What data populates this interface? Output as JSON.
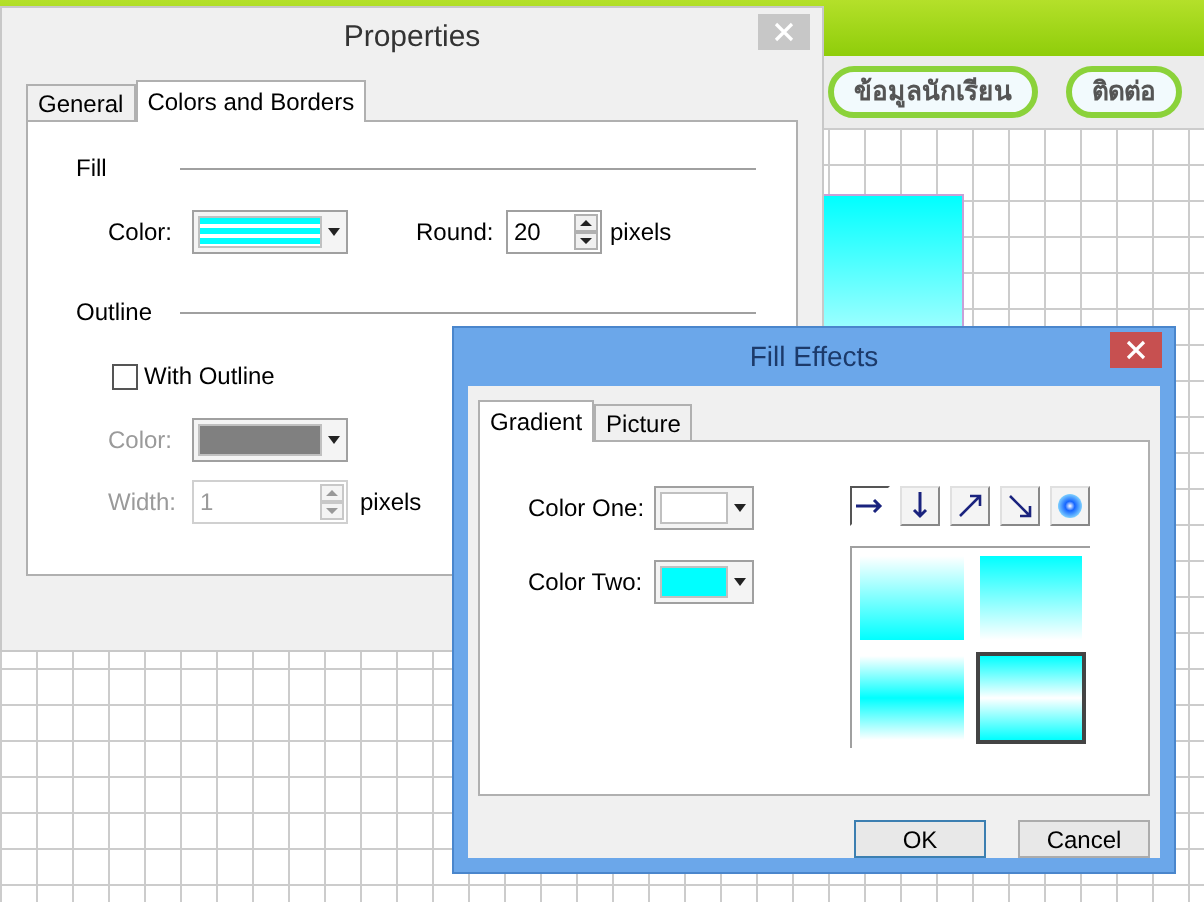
{
  "canvas": {
    "nav_buttons": [
      {
        "label": "ข้อมูลนักเรียน"
      },
      {
        "label": "ติดต่อ"
      }
    ]
  },
  "properties_dialog": {
    "title": "Properties",
    "tabs": [
      {
        "label": "General",
        "selected": false
      },
      {
        "label": "Colors and Borders",
        "selected": true
      }
    ],
    "fill": {
      "heading": "Fill",
      "color_label": "Color:",
      "round_label": "Round:",
      "round_value": "20",
      "round_unit": "pixels"
    },
    "outline": {
      "heading": "Outline",
      "with_outline": {
        "label": "With Outline",
        "checked": false
      },
      "disabled": true,
      "color_label": "Color:",
      "width_label": "Width:",
      "width_value": "1",
      "width_unit": "pixels"
    }
  },
  "fill_effects_dialog": {
    "title": "Fill Effects",
    "tabs": [
      {
        "label": "Gradient",
        "selected": true
      },
      {
        "label": "Picture",
        "selected": false
      }
    ],
    "color_one": {
      "label": "Color One:",
      "color": "#ffffff"
    },
    "color_two": {
      "label": "Color Two:",
      "color": "#00ffff"
    },
    "directions": [
      {
        "kind": "right",
        "selected": true
      },
      {
        "kind": "down",
        "selected": false
      },
      {
        "kind": "up-right",
        "selected": false
      },
      {
        "kind": "down-right",
        "selected": false
      },
      {
        "kind": "radial",
        "selected": false
      }
    ],
    "variants": [
      {
        "kind": "light-top",
        "selected": false
      },
      {
        "kind": "dark-top",
        "selected": false
      },
      {
        "kind": "dark-middle",
        "selected": false
      },
      {
        "kind": "light-middle",
        "selected": true
      }
    ],
    "buttons": [
      {
        "label": "OK"
      },
      {
        "label": "Cancel"
      }
    ]
  }
}
